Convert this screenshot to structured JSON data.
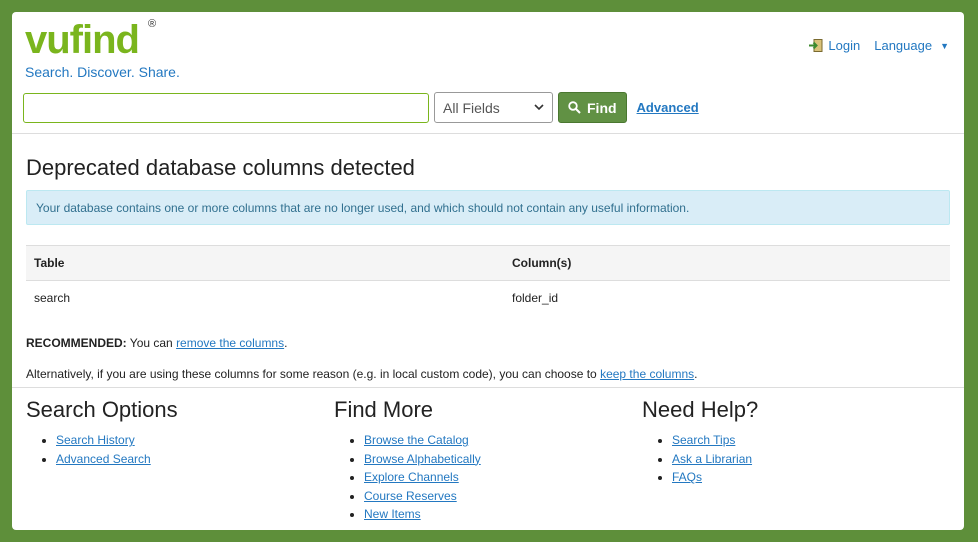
{
  "brand": {
    "logo_text": "vufind",
    "registered_mark": "®",
    "tagline": "Search. Discover. Share."
  },
  "top_nav": {
    "login_label": "Login",
    "language_label": "Language"
  },
  "search": {
    "placeholder": "",
    "value": "",
    "type_selected": "All Fields",
    "find_label": "Find",
    "advanced_label": "Advanced"
  },
  "main": {
    "title": "Deprecated database columns detected",
    "alert": "Your database contains one or more columns that are no longer used, and which should not contain any useful information.",
    "table": {
      "headers": [
        "Table",
        "Column(s)"
      ],
      "rows": [
        [
          "search",
          "folder_id"
        ]
      ]
    },
    "recommended_prefix": "RECOMMENDED:",
    "recommended_text": " You can ",
    "recommended_link": "remove the columns",
    "recommended_suffix": ".",
    "alt_text": "Alternatively, if you are using these columns for some reason (e.g. in local custom code), you can choose to ",
    "alt_link": "keep the columns",
    "alt_suffix": "."
  },
  "footer": {
    "columns": [
      {
        "title": "Search Options",
        "links": [
          "Search History",
          "Advanced Search"
        ]
      },
      {
        "title": "Find More",
        "links": [
          "Browse the Catalog",
          "Browse Alphabetically",
          "Explore Channels",
          "Course Reserves",
          "New Items"
        ]
      },
      {
        "title": "Need Help?",
        "links": [
          "Search Tips",
          "Ask a Librarian",
          "FAQs"
        ]
      }
    ]
  },
  "colors": {
    "brand_green": "#7ab51d",
    "link_blue": "#2378c1",
    "page_bg": "#5e8f3a"
  }
}
